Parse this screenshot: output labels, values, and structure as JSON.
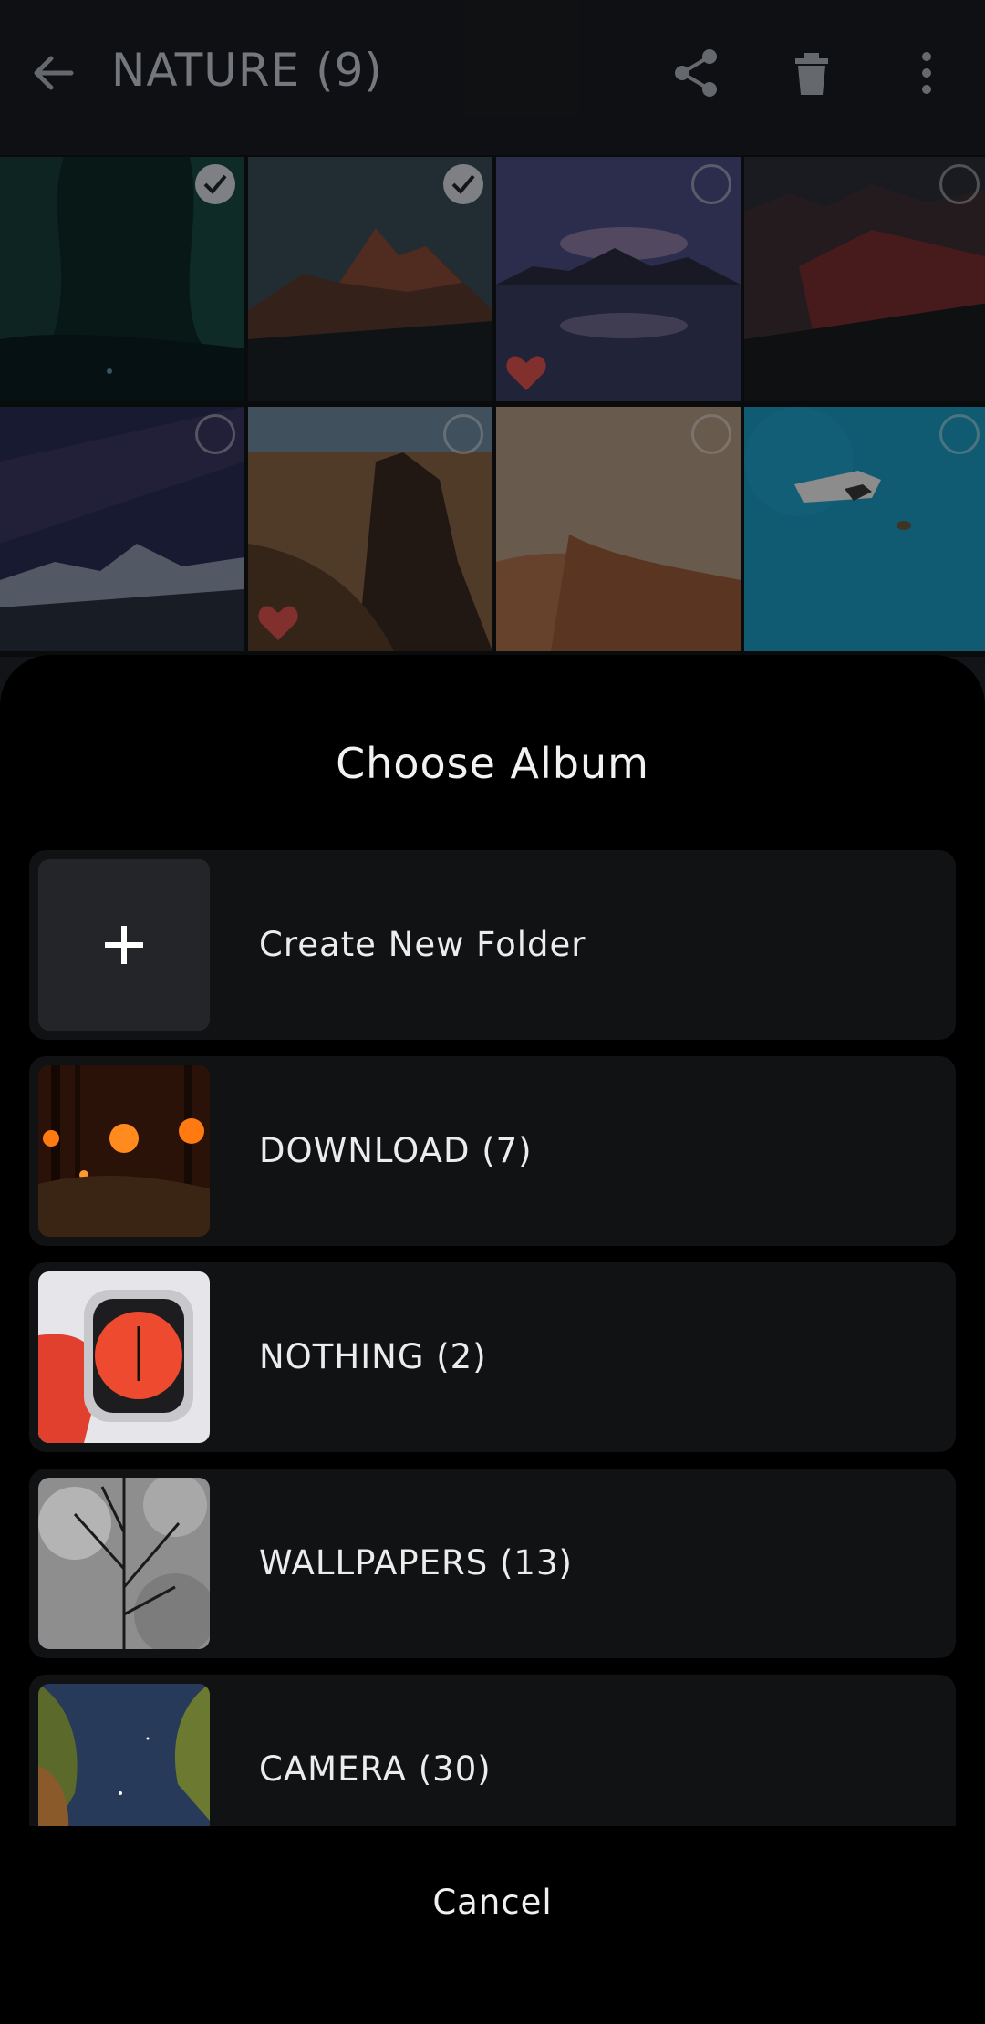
{
  "appbar": {
    "title": "NATURE (9)",
    "icons": [
      "back-arrow-icon",
      "share-icon",
      "delete-icon",
      "more-vert-icon"
    ]
  },
  "grid": {
    "photos": [
      {
        "scene": "cave",
        "selected": true,
        "favorite": false
      },
      {
        "scene": "mountain-peak",
        "selected": true,
        "favorite": false
      },
      {
        "scene": "lake-reflection",
        "selected": false,
        "favorite": true
      },
      {
        "scene": "red-mountains",
        "selected": false,
        "favorite": false
      },
      {
        "scene": "milky-way",
        "selected": false,
        "favorite": false
      },
      {
        "scene": "desert-rocks",
        "selected": false,
        "favorite": true
      },
      {
        "scene": "sand-dunes",
        "selected": false,
        "favorite": false
      },
      {
        "scene": "boat-ocean",
        "selected": false,
        "favorite": false
      }
    ]
  },
  "sheet": {
    "title": "Choose Album",
    "create_label": "Create New Folder",
    "albums": [
      {
        "label": "DOWNLOAD (7)"
      },
      {
        "label": "NOTHING (2)"
      },
      {
        "label": "WALLPAPERS (13)"
      },
      {
        "label": "CAMERA (30)"
      }
    ],
    "cancel_label": "Cancel"
  },
  "colors": {
    "sheet_bg": "#000000",
    "row_bg": "#111214",
    "favorite": "#e0534f"
  }
}
